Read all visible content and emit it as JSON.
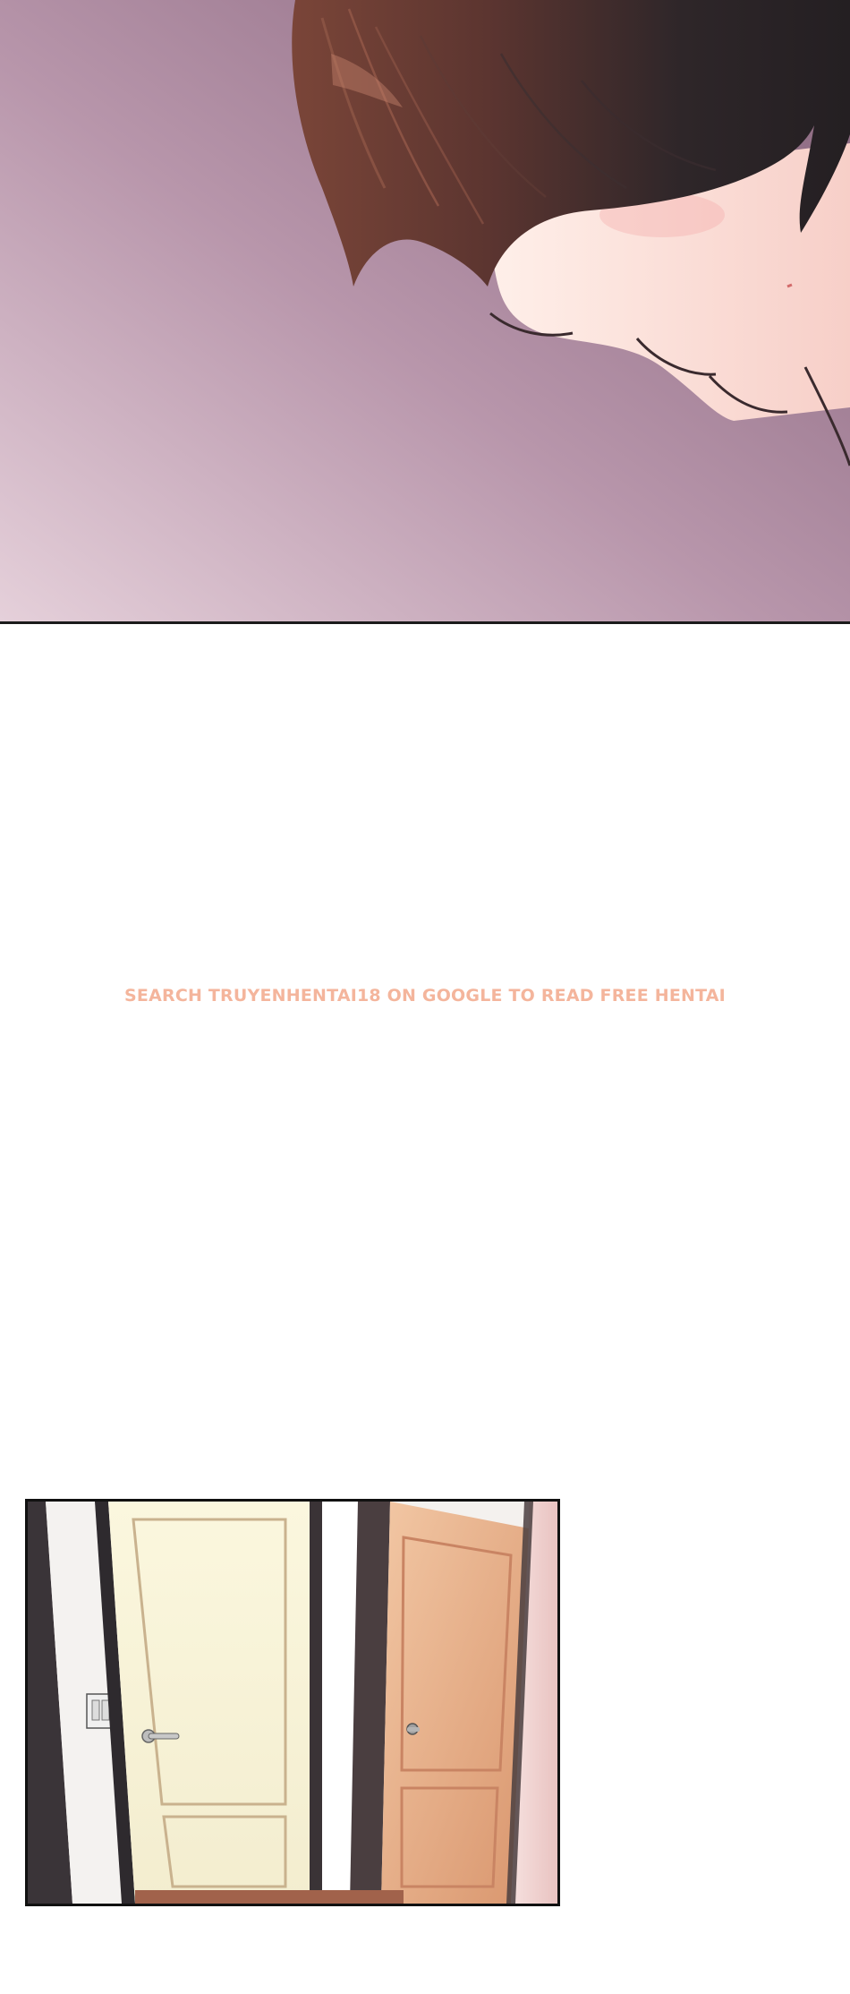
{
  "page": {
    "watermark_text": "SEARCH TRUYENHENTAI18 ON GOOGLE TO READ FREE HENTAI"
  },
  "colors": {
    "bg_purple_dark": "#8e6b82",
    "bg_purple_light": "#e2cbd6",
    "hair_dark": "#2b2427",
    "hair_brown": "#6b3f36",
    "skin": "#fde3dc",
    "watermark": "#f4b59c",
    "door_cream": "#f7f3d2",
    "door_tan": "#e6ae89",
    "wall_pink": "#f1d4d2"
  },
  "panels": [
    {
      "name": "character-closeup-panel",
      "subject": "dark-haired character looking down"
    },
    {
      "name": "hallway-doors-panel",
      "subject": "two doors in a hallway, right door ajar"
    }
  ]
}
